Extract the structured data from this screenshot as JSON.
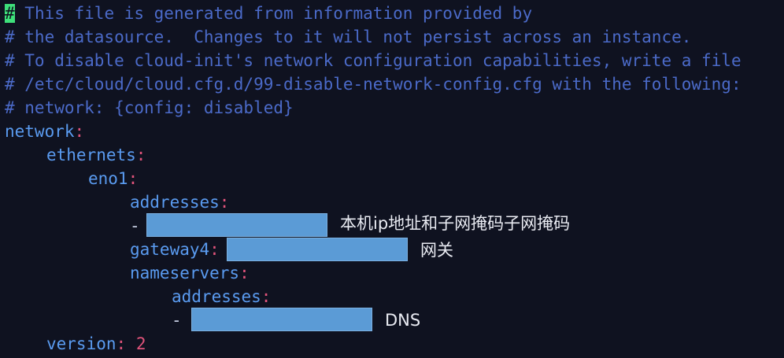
{
  "editor": {
    "comments": [
      "# This file is generated from information provided by",
      "# the datasource.  Changes to it will not persist across an instance.",
      "# To disable cloud-init's network configuration capabilities, write a file",
      "# /etc/cloud/cloud.cfg.d/99-disable-network-config.cfg with the following:",
      "# network: {config: disabled}"
    ],
    "cursor_char": "#",
    "comment_first_rest": " This file is generated from information provided by",
    "yaml": {
      "network": "network",
      "ethernets": "ethernets",
      "interface": "eno1",
      "addresses": "addresses",
      "gateway": "gateway4",
      "nameservers": "nameservers",
      "ns_addresses": "addresses",
      "version_key": "version",
      "version_value": "2",
      "dash": "-",
      "colon": ":"
    }
  },
  "annotations": {
    "address_note": "本机ip地址和子网掩码子网掩码",
    "gateway_note": "网关",
    "dns_note": "DNS"
  },
  "colors": {
    "background": "#0f1220",
    "comment": "#4b6ac8",
    "key": "#5a9bf0",
    "punctuation": "#e0537a",
    "cursor": "#3ee07a",
    "redaction": "#5b9bd6"
  }
}
